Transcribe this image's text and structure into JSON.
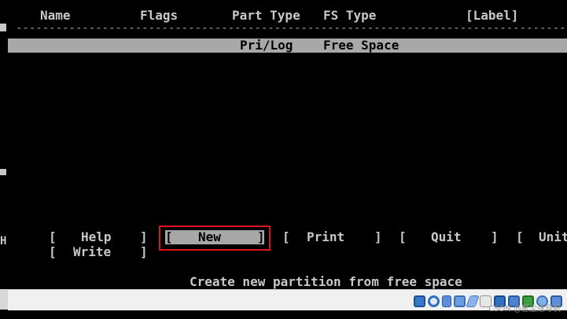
{
  "header": {
    "name": "Name",
    "flags": "Flags",
    "part_type": "Part Type",
    "fs_type": "FS Type",
    "label": "[Label]"
  },
  "divider": "---------------------------------------------------------------------------------------------",
  "partition_row": {
    "part_type": "Pri/Log",
    "fs_type": "Free Space"
  },
  "side_letter": "H",
  "menu": {
    "help": {
      "open": "[",
      "label": "Help",
      "close": "]"
    },
    "new": {
      "open": "[",
      "label": "New",
      "close": "]"
    },
    "print": {
      "open": "[",
      "label": "Print",
      "close": "]"
    },
    "quit": {
      "open": "[",
      "label": "Quit",
      "close": "]"
    },
    "units": {
      "open": "[",
      "label": "Unit"
    },
    "write": {
      "open": "[",
      "label": "Write",
      "close": "]"
    }
  },
  "status_text": "Create new partition from free space",
  "watermark": "CSDN @星尘逐导帆",
  "taskbar": {
    "tray_icons": [
      "hdd-icon",
      "cd-icon",
      "usb-icon",
      "network-icon",
      "pen-icon",
      "folder-icon",
      "display-icon",
      "video-icon",
      "cpu-icon",
      "mouse-icon",
      "keyboard-icon"
    ]
  },
  "colors": {
    "background": "#000000",
    "text": "#c8c8c8",
    "highlight": "#a8a8a8",
    "highlight_text": "#000000",
    "annotation_red": "#e0141e"
  }
}
